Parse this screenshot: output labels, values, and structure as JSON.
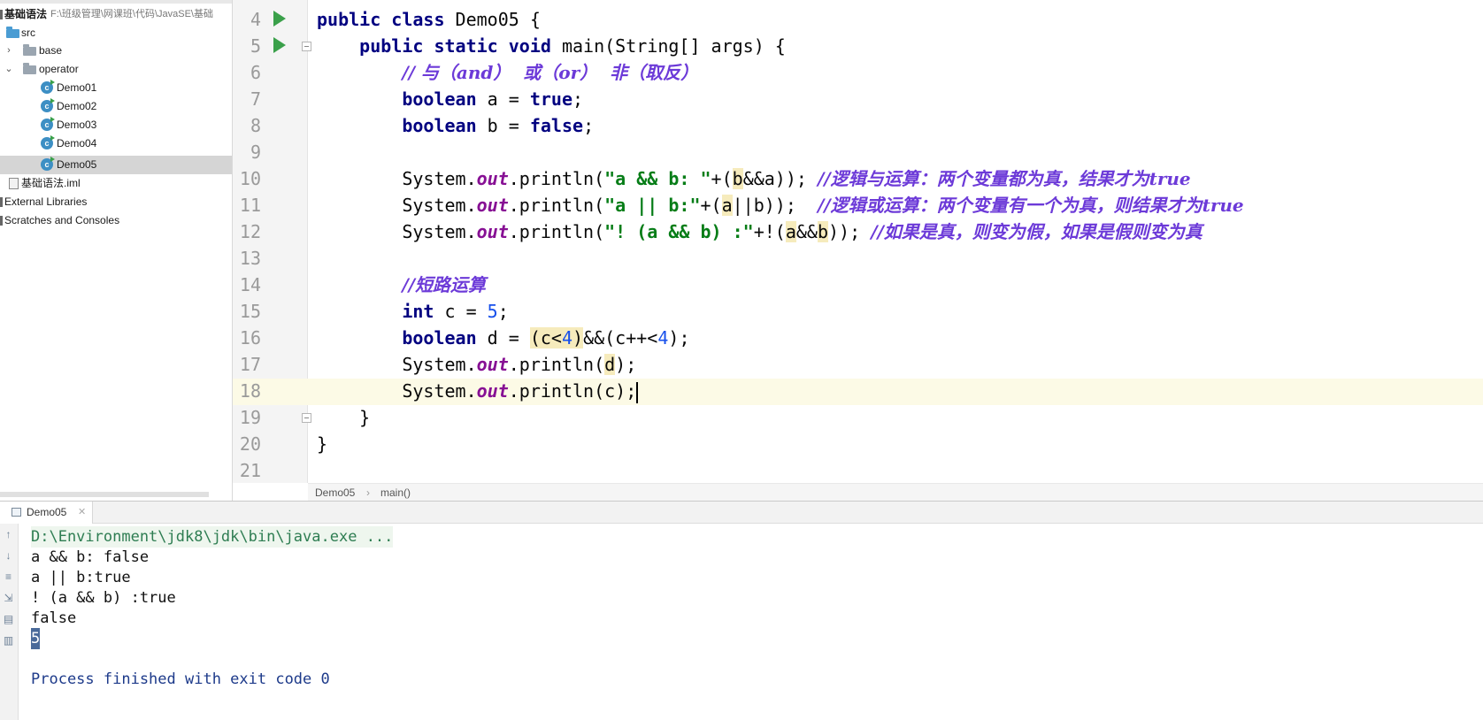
{
  "project": {
    "name": "基础语法",
    "path": "F:\\班级管理\\网课班\\代码\\JavaSE\\基础",
    "tree": {
      "src": "src",
      "base": "base",
      "operator": "operator",
      "classes": [
        "Demo01",
        "Demo02",
        "Demo03",
        "Demo04",
        "Demo05"
      ],
      "selected": "Demo05",
      "iml": "基础语法.iml",
      "external": "External Libraries",
      "scratches": "Scratches and Consoles"
    }
  },
  "editor": {
    "line_numbers": [
      "4",
      "5",
      "6",
      "7",
      "8",
      "9",
      "10",
      "11",
      "12",
      "13",
      "14",
      "15",
      "16",
      "17",
      "18",
      "19",
      "20",
      "21"
    ],
    "current_line": "18",
    "breadcrumb": [
      "Demo05",
      "main()"
    ]
  },
  "console": {
    "tab": "Demo05",
    "command": "D:\\Environment\\jdk8\\jdk\\bin\\java.exe ...",
    "lines": [
      "a && b: false",
      "a || b:true",
      "! (a && b) :true",
      "false",
      "5"
    ],
    "exit": "Process finished with exit code 0"
  },
  "colors": {
    "keyword": "#000080",
    "string": "#067d17",
    "number": "#1750eb",
    "static_field": "#871094",
    "comment": "#6c3ad8",
    "current_line": "#fcfae6",
    "run_icon": "#3aa04a"
  },
  "icons": [
    "run-gutter-icon",
    "fold-icon",
    "folder-icon",
    "class-icon",
    "close-icon"
  ]
}
